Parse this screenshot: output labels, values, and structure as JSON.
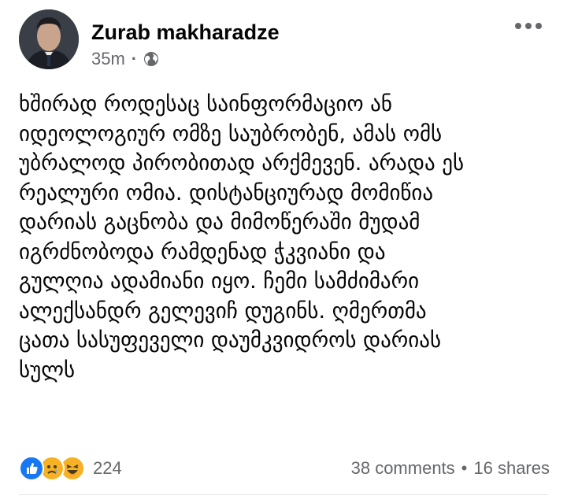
{
  "post": {
    "author": "Zurab makharadze",
    "time": "35m",
    "privacy_icon": "globe-icon",
    "more_icon": "more-horizontal-icon",
    "lines": [
      "ხშირად როდესაც საინფორმაციო ან",
      "იდეოლოგიურ ომზე საუბრობენ, ამას ომს",
      "უბრალოდ პირობითად არქმევენ. არადა ეს",
      "რეალური ომია. დისტანციურად მომიწია",
      "დარიას გაცნობა და მიმოწერაში მუდამ",
      "იგრძნობოდა რამდენად ჭკვიანი და",
      "გულღია ადამიანი იყო. ჩემი სამძიმარი",
      "ალექსანდრ გელევიჩ დუგინს. ღმერთმა",
      "ცათა სასუფეველი დაუმკვიდროს დარიას",
      "სულს"
    ]
  },
  "footer": {
    "reaction_icons": [
      "like-icon",
      "sad-icon",
      "haha-icon"
    ],
    "reaction_count": "224",
    "comments": "38 comments",
    "separator": "•",
    "shares": "16 shares"
  },
  "colors": {
    "like_blue": "#1877f2",
    "emoji_yellow": "#f7b125",
    "meta_gray": "#65676b"
  }
}
